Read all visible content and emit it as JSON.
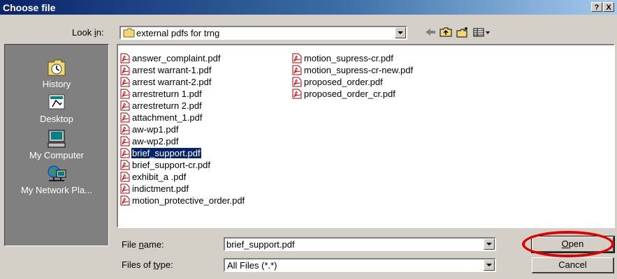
{
  "window": {
    "title": "Choose file",
    "help_button": "?",
    "close_button": "X"
  },
  "lookin": {
    "label_pre": "Look ",
    "label_key": "i",
    "label_post": "n:",
    "value": "external  pdfs for trng",
    "icon": "folder-icon"
  },
  "toolbar": {
    "icons": [
      "back-icon",
      "up-folder-icon",
      "new-folder-icon",
      "view-menu-icon"
    ]
  },
  "places": [
    {
      "label": "History",
      "icon": "history-icon"
    },
    {
      "label": "Desktop",
      "icon": "desktop-icon"
    },
    {
      "label": "My Computer",
      "icon": "my-computer-icon"
    },
    {
      "label": "My Network Pla...",
      "icon": "network-icon"
    }
  ],
  "files": {
    "column1": [
      "answer_complaint.pdf",
      "arrest warrant-1.pdf",
      "arrest warrant-2.pdf",
      "arrestreturn 1.pdf",
      "arrestreturn 2.pdf",
      "attachment_1.pdf",
      "aw-wp1.pdf",
      "aw-wp2.pdf",
      "brief_support.pdf",
      "brief_support-cr.pdf",
      "exhibit_a .pdf",
      "indictment.pdf",
      "motion_protective_order.pdf"
    ],
    "column2": [
      "motion_supress-cr.pdf",
      "motion_supress-cr-new.pdf",
      "proposed_order.pdf",
      "proposed_order_cr.pdf"
    ],
    "selected": "brief_support.pdf",
    "icon": "pdf-file-icon"
  },
  "filename": {
    "label_pre": "File ",
    "label_key": "n",
    "label_post": "ame:",
    "value": "brief_support.pdf"
  },
  "filetype": {
    "label_pre": "Files of ",
    "label_key": "t",
    "label_post": "ype:",
    "value": "All Files (*.*)"
  },
  "buttons": {
    "open_key": "O",
    "open_rest": "pen",
    "cancel": "Cancel"
  },
  "colors": {
    "titlebar": "#0a246a",
    "selection": "#0a246a",
    "annotation": "#e00000",
    "face": "#d4d0c8"
  }
}
